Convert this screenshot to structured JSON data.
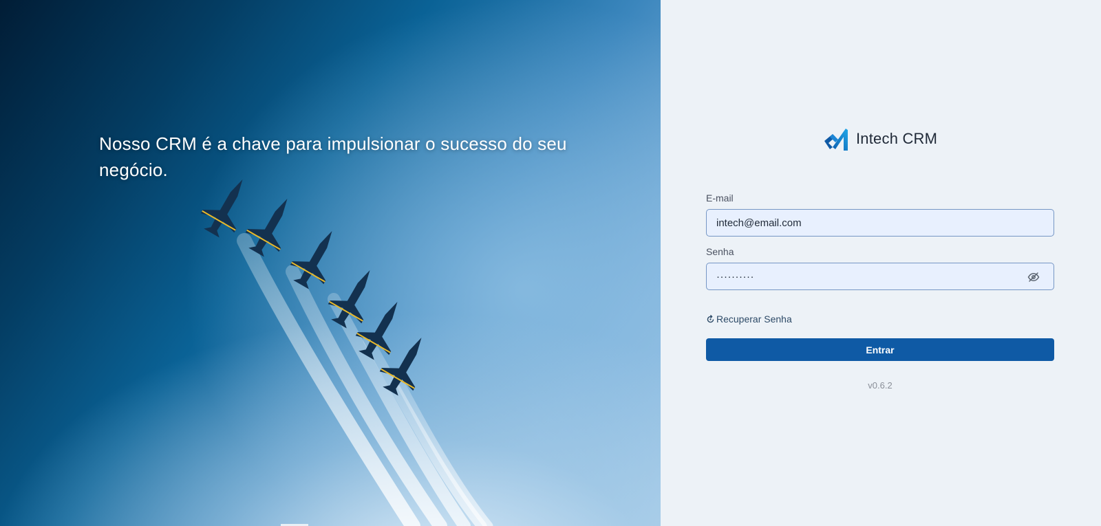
{
  "hero": {
    "tagline": "Nosso CRM é a chave para impulsionar o sucesso do seu negócio."
  },
  "brand": {
    "name": "Intech CRM",
    "logo_icon": "intech-logo-icon"
  },
  "form": {
    "email_label": "E-mail",
    "email_value": "intech@email.com",
    "password_label": "Senha",
    "password_mask": "··········",
    "password_toggle_icon": "eye-off-icon",
    "recover_icon": "refresh-icon",
    "recover_label": "Recuperar Senha",
    "submit_label": "Entrar"
  },
  "footer": {
    "version": "v0.6.2"
  },
  "colors": {
    "primary": "#0f5aa5",
    "panel_bg": "#edf2f7",
    "input_bg": "#e8f0fe",
    "input_border": "#7596c4"
  }
}
